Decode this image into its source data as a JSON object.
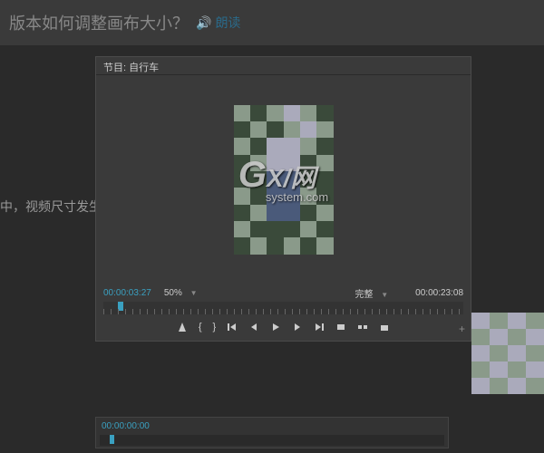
{
  "topbar": {
    "title": "版本如何调整画布大小？",
    "audio_label": "朗读"
  },
  "hint": "中，视频尺寸发生",
  "panel": {
    "tab_label": "节目: 自行车",
    "timecode_left": "00:00:03:27",
    "zoom_level": "50%",
    "quality_label": "完整",
    "timecode_right": "00:00:23:08"
  },
  "watermark": {
    "g": "G",
    "x": "X",
    "net": "网",
    "sys": "system.com"
  },
  "bg_timeline": {
    "timecode": "00:00:00:00"
  }
}
